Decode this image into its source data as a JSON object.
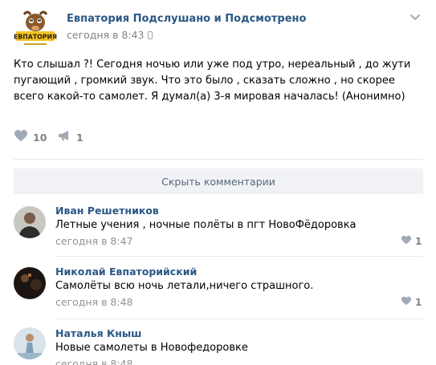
{
  "post": {
    "group_name": "Евпатория Подслушано и Подсмотрено",
    "time": "сегодня в 8:43",
    "avatar_text": "ЕВПАТОРИЯ",
    "text": "Кто слышал ?! Сегодня ночью или уже под утро, нереальный , до жути пугающий , громкий звук. Что это было , сказать сложно , но скорее всего какой-то самолет. Я думал(а) 3-я мировая началась! (Анонимно)",
    "likes": "10",
    "shares": "1",
    "icons": {
      "like": "heart-icon",
      "share": "megaphone-icon",
      "more": "chevron-down-icon",
      "device": "mobile-icon"
    }
  },
  "comments_toggle": {
    "label": "Скрыть комментарии"
  },
  "comments": [
    {
      "author": "Иван Решетников",
      "text": "Летные учения , ночные полёты в пгт НовоФёдоровка",
      "time": "сегодня в 8:47",
      "likes": "1"
    },
    {
      "author": "Николай Евпаторийский",
      "text": "Самолёты всю ночь летали,ничего страшного.",
      "time": "сегодня в 8:48",
      "likes": "1"
    },
    {
      "author": "Наталья Кныш",
      "text": "Новые самолеты в Новофедоровке",
      "time": "сегодня в 8:48",
      "likes": ""
    }
  ],
  "colors": {
    "link": "#2a5885",
    "muted": "#828282",
    "button_bg": "#f0f2f5",
    "icon": "#a0aab7"
  }
}
